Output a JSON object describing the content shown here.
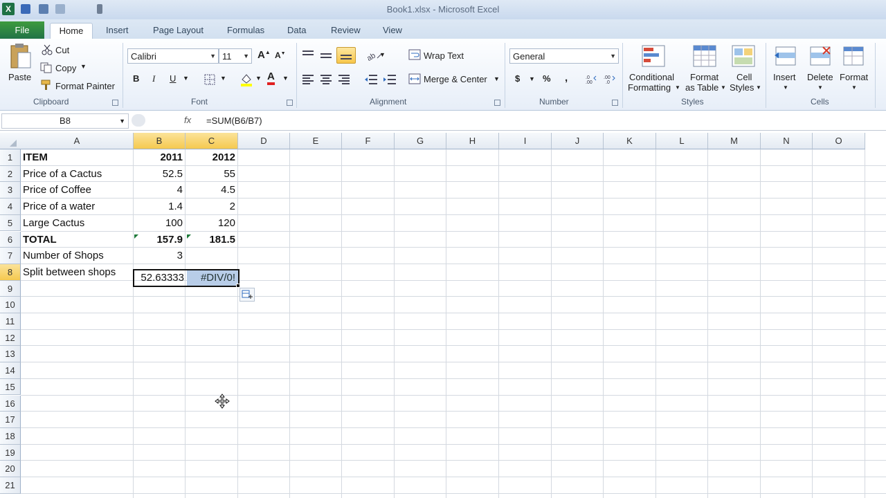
{
  "window": {
    "title": "Book1.xlsx - Microsoft Excel",
    "app_logo": "X"
  },
  "tabs": [
    "File",
    "Home",
    "Insert",
    "Page Layout",
    "Formulas",
    "Data",
    "Review",
    "View"
  ],
  "ribbon": {
    "clipboard": {
      "label": "Clipboard",
      "paste": "Paste",
      "cut": "Cut",
      "copy": "Copy",
      "format_painter": "Format Painter"
    },
    "font": {
      "label": "Font",
      "name": "Calibri",
      "size": "11",
      "bold": "B",
      "italic": "I",
      "underline": "U",
      "font_color_letter": "A"
    },
    "alignment": {
      "label": "Alignment",
      "wrap_text": "Wrap Text",
      "merge_center": "Merge & Center"
    },
    "number": {
      "label": "Number",
      "format": "General",
      "currency": "$",
      "percent": "%",
      "comma": ","
    },
    "styles": {
      "label": "Styles",
      "conditional": "Conditional",
      "conditional2": "Formatting",
      "format_table": "Format",
      "format_table2": "as Table",
      "cell_styles": "Cell",
      "cell_styles2": "Styles"
    },
    "cells": {
      "label": "Cells",
      "insert": "Insert",
      "delete": "Delete",
      "format": "Format"
    }
  },
  "formula_bar": {
    "name_box": "B8",
    "fx": "fx",
    "formula": "=SUM(B6/B7)"
  },
  "columns": [
    "A",
    "B",
    "C",
    "D",
    "E",
    "F",
    "G",
    "H",
    "I",
    "J",
    "K",
    "L",
    "M",
    "N",
    "O"
  ],
  "rows": [
    "1",
    "2",
    "3",
    "4",
    "5",
    "6",
    "7",
    "8",
    "9",
    "10",
    "11",
    "12",
    "13",
    "14",
    "15",
    "16",
    "17",
    "18",
    "19",
    "20",
    "21"
  ],
  "cells": {
    "r1": {
      "a": "ITEM",
      "b": "2011",
      "c": "2012"
    },
    "r2": {
      "a": "Price of a Cactus",
      "b": "52.5",
      "c": "55"
    },
    "r3": {
      "a": "Price of Coffee",
      "b": "4",
      "c": "4.5"
    },
    "r4": {
      "a": "Price of a water",
      "b": "1.4",
      "c": "2"
    },
    "r5": {
      "a": "Large Cactus",
      "b": "100",
      "c": "120"
    },
    "r6": {
      "a": "TOTAL",
      "b": "157.9",
      "c": "181.5"
    },
    "r7": {
      "a": "Number of Shops",
      "b": "3",
      "c": ""
    },
    "r8": {
      "a": "Split between shops",
      "b": "52.63333",
      "c": "#DIV/0!"
    }
  },
  "selection": {
    "active_cell": "B8",
    "selected_columns": [
      "B",
      "C"
    ],
    "selected_row": "8"
  },
  "colors": {
    "file_tab": "#217346",
    "selection_highlight": "#f5c94f",
    "error_cell_bg": "#b8cde8"
  }
}
